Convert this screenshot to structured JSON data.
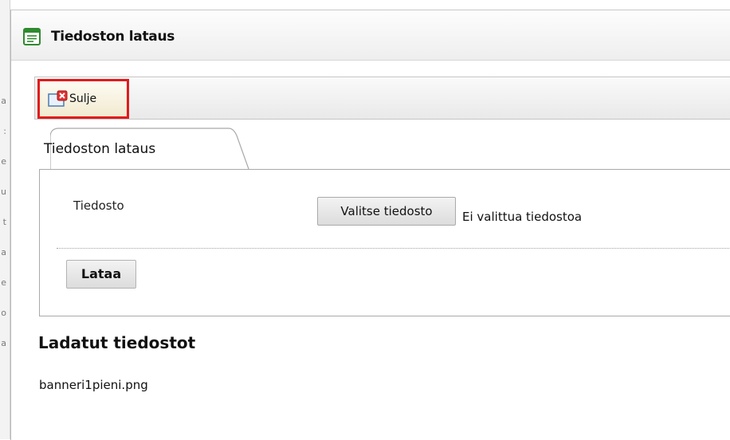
{
  "window": {
    "title": "Tiedoston lataus"
  },
  "background_letters": [
    "a",
    ":",
    "e",
    "u",
    "t",
    "a",
    "e",
    "o",
    "a"
  ],
  "toolbar": {
    "close_label": "Sulje"
  },
  "tab": {
    "label": "Tiedoston lataus"
  },
  "form": {
    "file_label": "Tiedosto",
    "choose_button": "Valitse tiedosto",
    "no_file_text": "Ei valittua tiedostoa",
    "upload_button": "Lataa"
  },
  "uploaded": {
    "title": "Ladatut tiedostot",
    "files": [
      "banneri1pieni.png"
    ]
  },
  "colors": {
    "highlight_border": "#e21b1b",
    "icon_green": "#2f8a2f",
    "close_icon_red": "#e03232"
  },
  "icons": {
    "title": "form-window-icon",
    "close": "close-window-icon"
  }
}
